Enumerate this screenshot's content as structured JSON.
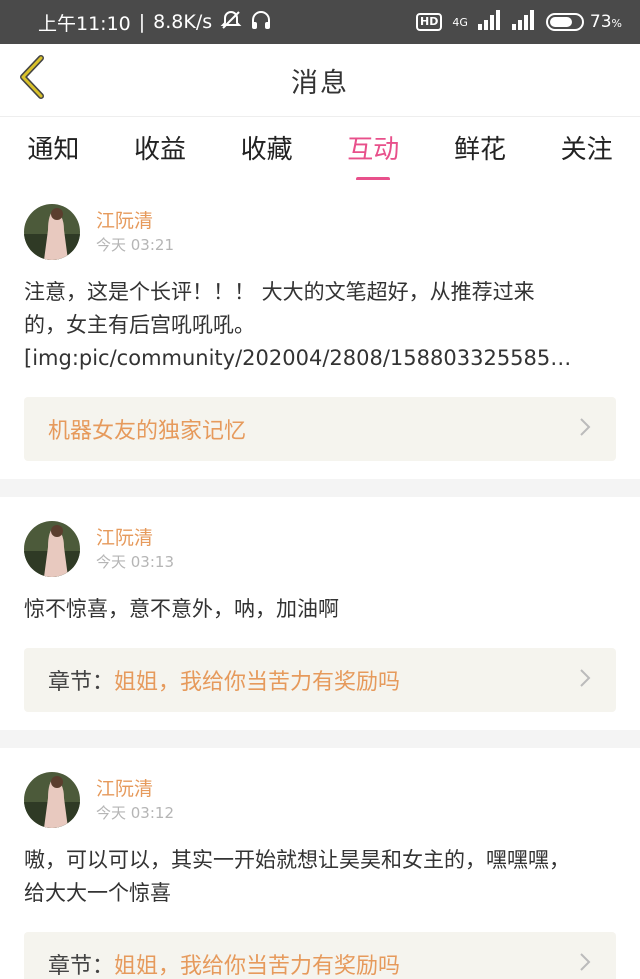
{
  "status_bar": {
    "time": "上午11:10",
    "network_speed": "8.8K/s",
    "separator": "|",
    "hd_label": "HD",
    "net_type": "4G",
    "battery_percent": "73",
    "battery_unit": "%",
    "battery_level": 0.73,
    "icons": [
      "alarm-off-icon",
      "headphones-icon",
      "signal-icon",
      "signal-icon"
    ]
  },
  "header": {
    "title": "消息",
    "back_icon": "chevron-left-icon",
    "accent": "#d9c12a"
  },
  "tabs": [
    {
      "label": "通知",
      "active": false
    },
    {
      "label": "收益",
      "active": false
    },
    {
      "label": "收藏",
      "active": false
    },
    {
      "label": "互动",
      "active": true
    },
    {
      "label": "鲜花",
      "active": false
    },
    {
      "label": "关注",
      "active": false
    }
  ],
  "colors": {
    "active_tab": "#e8508b",
    "username": "#e69a5c",
    "link_bg": "#f5f4ee"
  },
  "items": [
    {
      "username": "江阮清",
      "time": "今天 03:21",
      "comment": "注意，这是个长评！！！ 大大的文笔超好，从推荐过来的，女主有后宫吼吼吼。 [img:pic/community/202004/2808/158803325585…",
      "link_prefix": "",
      "link_text": "机器女友的独家记忆"
    },
    {
      "username": "江阮清",
      "time": "今天 03:13",
      "comment": "惊不惊喜，意不意外，呐，加油啊",
      "link_prefix": "章节：",
      "link_text": "姐姐，我给你当苦力有奖励吗"
    },
    {
      "username": "江阮清",
      "time": "今天 03:12",
      "comment": "嗷，可以可以，其实一开始就想让昊昊和女主的，嘿嘿嘿，给大大一个惊喜",
      "link_prefix": "章节：",
      "link_text": "姐姐，我给你当苦力有奖励吗"
    }
  ]
}
